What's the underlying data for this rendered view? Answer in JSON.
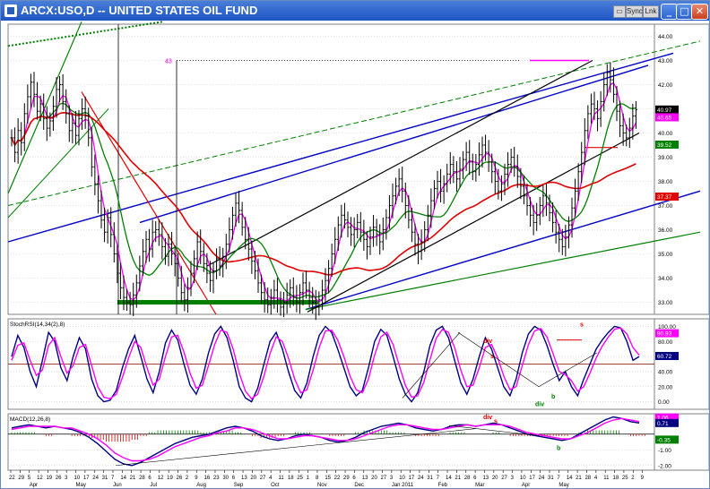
{
  "window": {
    "title": "ARCX:USO,D -- UNITED STATES OIL FUND",
    "toolbar_buttons": [
      "▭",
      "Sync",
      "Lnk"
    ],
    "minimize_icon": "minimize-icon",
    "maximize_icon": "maximize-icon",
    "close_icon": "close-icon"
  },
  "colors": {
    "price_bars": "#000000",
    "magenta": "#ff00ff",
    "green": "#008000",
    "red": "#e00000",
    "blue": "#0000c8",
    "navy": "#000080",
    "grid": "#c8c8c8"
  },
  "chart_data": [
    {
      "type": "bar",
      "title": "ARCX:USO,D -- UNITED STATES OIL FUND",
      "xlabel": "",
      "ylabel": "",
      "ylim": [
        32.5,
        44.5
      ],
      "grid": true,
      "y_ticks": [
        "44.00",
        "43.00",
        "42.00",
        "41.00",
        "40.00",
        "39.00",
        "38.00",
        "37.00",
        "36.00",
        "35.00",
        "34.00",
        "33.00"
      ],
      "price_tags": [
        {
          "label": "40.97",
          "value": 40.97,
          "bg": "#000000",
          "fg": "#ffffff"
        },
        {
          "label": "40.65",
          "value": 40.65,
          "bg": "#ff00ff",
          "fg": "#ffffff"
        },
        {
          "label": "39.52",
          "value": 39.52,
          "bg": "#008000",
          "fg": "#ffffff"
        },
        {
          "label": "37.37",
          "value": 37.37,
          "bg": "#e00000",
          "fg": "#ffffff"
        }
      ],
      "annotations": [
        {
          "text": "43",
          "color": "#ff00ff"
        }
      ],
      "close_series": [
        39.8,
        39.2,
        40.1,
        39.6,
        40.8,
        41.5,
        42.1,
        41.6,
        40.9,
        41.2,
        40.6,
        40.2,
        40.5,
        41.1,
        41.8,
        42.0,
        41.3,
        40.8,
        40.1,
        40.4,
        39.9,
        40.6,
        41.0,
        40.7,
        39.8,
        38.6,
        37.9,
        37.2,
        36.4,
        35.9,
        36.5,
        35.8,
        35.0,
        34.2,
        33.6,
        33.2,
        33.0,
        32.9,
        33.3,
        33.8,
        34.5,
        35.1,
        35.6,
        35.2,
        35.9,
        36.0,
        35.8,
        35.3,
        34.9,
        35.4,
        35.0,
        34.6,
        34.0,
        33.4,
        33.1,
        33.6,
        34.2,
        34.8,
        35.5,
        35.1,
        34.6,
        34.2,
        33.9,
        34.3,
        34.8,
        34.5,
        34.9,
        35.4,
        36.0,
        36.6,
        37.1,
        36.8,
        36.1,
        35.6,
        35.2,
        34.7,
        34.3,
        33.8,
        33.4,
        33.1,
        32.9,
        33.2,
        33.5,
        33.1,
        32.8,
        33.0,
        33.3,
        33.6,
        33.2,
        33.0,
        33.4,
        33.8,
        33.5,
        33.2,
        33.0,
        32.8,
        33.1,
        33.5,
        33.9,
        34.4,
        35.0,
        35.6,
        36.2,
        36.6,
        36.4,
        36.1,
        35.8,
        36.0,
        36.3,
        35.9,
        35.6,
        35.3,
        35.7,
        36.1,
        35.8,
        35.5,
        36.0,
        36.5,
        37.0,
        37.4,
        37.8,
        38.1,
        37.6,
        37.0,
        36.4,
        35.9,
        35.4,
        35.1,
        35.5,
        36.0,
        36.6,
        37.2,
        37.7,
        38.0,
        37.6,
        37.9,
        38.3,
        38.7,
        38.4,
        38.1,
        38.5,
        38.9,
        39.2,
        38.8,
        38.4,
        38.7,
        39.1,
        39.5,
        39.2,
        38.8,
        38.4,
        38.0,
        37.6,
        37.9,
        38.3,
        38.7,
        39.0,
        38.6,
        38.2,
        37.8,
        37.4,
        37.0,
        36.6,
        36.3,
        36.6,
        37.0,
        37.4,
        37.1,
        36.7,
        36.3,
        35.9,
        35.6,
        35.3,
        35.7,
        36.2,
        36.9,
        37.6,
        38.4,
        39.2,
        40.1,
        40.8,
        41.2,
        41.0,
        40.6,
        41.3,
        42.0,
        42.5,
        42.2,
        41.6,
        40.9,
        40.3,
        40.0,
        39.8,
        40.2,
        40.7,
        40.97
      ],
      "moving_averages": [
        {
          "name": "",
          "color": "#ff00ff"
        },
        {
          "name": "",
          "color": "#008000"
        },
        {
          "name": "",
          "color": "#e00000"
        }
      ],
      "date_ticks": [
        "22",
        "29",
        "5",
        "12",
        "19",
        "26",
        "3",
        "10",
        "17",
        "24",
        "31",
        "7",
        "14",
        "21",
        "28",
        "6",
        "12",
        "19",
        "26",
        "2",
        "9",
        "16",
        "23",
        "30",
        "6",
        "13",
        "20",
        "27",
        "4",
        "11",
        "18",
        "25",
        "1",
        "8",
        "15",
        "22",
        "29",
        "6",
        "13",
        "20",
        "27",
        "3",
        "10",
        "17",
        "24",
        "31",
        "7",
        "14",
        "21",
        "28",
        "6",
        "13",
        "20",
        "27",
        "3",
        "10",
        "17",
        "24",
        "31",
        "7",
        "14",
        "21",
        "28",
        "4",
        "11",
        "18",
        "25",
        "2",
        "9"
      ],
      "month_labels": [
        "Apr",
        "May",
        "Jun",
        "Jul",
        "Aug",
        "Sep",
        "Oct",
        "Nov",
        "Dec",
        "Jan 2011",
        "Feb",
        "Mar",
        "Apr",
        "May"
      ]
    },
    {
      "type": "line",
      "title": "StochRSI(14,34(2),8)",
      "xlabel": "",
      "ylabel": "",
      "ylim": [
        -10,
        110
      ],
      "grid": true,
      "y_ticks": [
        "100.00",
        "80.00",
        "60.00",
        "40.00",
        "20.00",
        "0.00"
      ],
      "price_tags": [
        {
          "label": "90.93",
          "value": 90.93,
          "bg": "#ff00ff",
          "fg": "#ffffff"
        },
        {
          "label": "60.72",
          "value": 60.72,
          "bg": "#000080",
          "fg": "#ffffff"
        }
      ],
      "annotations": [
        {
          "text": "div",
          "color": "#e00000"
        },
        {
          "text": "s",
          "color": "#e00000"
        },
        {
          "text": "s",
          "color": "#e00000"
        },
        {
          "text": "div",
          "color": "#008000"
        },
        {
          "text": "b",
          "color": "#008000"
        }
      ],
      "series": [
        {
          "name": "",
          "color": "#000080",
          "values": [
            60,
            88,
            72,
            40,
            20,
            55,
            92,
            80,
            45,
            28,
            60,
            85,
            70,
            30,
            8,
            0,
            2,
            15,
            45,
            70,
            88,
            60,
            30,
            12,
            40,
            78,
            95,
            82,
            50,
            22,
            10,
            30,
            65,
            90,
            100,
            85,
            55,
            20,
            5,
            0,
            18,
            50,
            80,
            92,
            70,
            40,
            15,
            5,
            25,
            60,
            88,
            100,
            92,
            70,
            45,
            20,
            8,
            15,
            45,
            80,
            96,
            88,
            60,
            30,
            10,
            0,
            12,
            40,
            75,
            95,
            100,
            85,
            55,
            25,
            10,
            30,
            60,
            85,
            70,
            45,
            20,
            8,
            30,
            65,
            90,
            100,
            95,
            75,
            50,
            28,
            40,
            20,
            8,
            30,
            50,
            70,
            82,
            92,
            100,
            98,
            80,
            55,
            60
          ]
        },
        {
          "name": "",
          "color": "#ff00ff",
          "values": [
            55,
            75,
            78,
            55,
            35,
            42,
            75,
            85,
            60,
            38,
            48,
            72,
            76,
            48,
            20,
            6,
            4,
            10,
            32,
            58,
            80,
            72,
            45,
            22,
            30,
            60,
            86,
            88,
            66,
            38,
            18,
            22,
            48,
            76,
            95,
            92,
            70,
            38,
            14,
            4,
            10,
            34,
            64,
            86,
            80,
            58,
            30,
            12,
            16,
            42,
            72,
            94,
            95,
            82,
            60,
            34,
            16,
            12,
            30,
            62,
            86,
            92,
            76,
            48,
            22,
            6,
            8,
            26,
            56,
            84,
            96,
            92,
            72,
            42,
            20,
            22,
            45,
            72,
            76,
            58,
            34,
            16,
            20,
            48,
            76,
            94,
            97,
            86,
            64,
            40,
            36,
            28,
            14,
            20,
            38,
            58,
            74,
            86,
            96,
            98,
            90,
            72,
            62
          ]
        }
      ]
    },
    {
      "type": "bar",
      "title": "MACD(12,26,8)",
      "xlabel": "",
      "ylabel": "",
      "ylim": [
        -2.3,
        1.3
      ],
      "grid": true,
      "y_ticks": [
        "1.00",
        "-1.00",
        "-2.00"
      ],
      "price_tags": [
        {
          "label": "1.06",
          "value": 1.06,
          "bg": "#ff00ff",
          "fg": "#ffffff"
        },
        {
          "label": "0.71",
          "value": 0.71,
          "bg": "#000080",
          "fg": "#ffffff"
        },
        {
          "label": "-0.35",
          "value": -0.35,
          "bg": "#008000",
          "fg": "#ffffff"
        }
      ],
      "annotations": [
        {
          "text": "div",
          "color": "#e00000"
        },
        {
          "text": "s",
          "color": "#e00000"
        },
        {
          "text": "b",
          "color": "#008000"
        }
      ],
      "series": [
        {
          "name": "",
          "color": "#000080",
          "values": [
            0.4,
            0.5,
            0.6,
            0.5,
            0.4,
            0.5,
            0.4,
            0.3,
            0.1,
            -0.2,
            -0.6,
            -1.1,
            -1.6,
            -1.9,
            -2.0,
            -1.8,
            -1.5,
            -1.2,
            -0.9,
            -0.6,
            -0.4,
            -0.2,
            -0.1,
            0.0,
            0.2,
            0.4,
            0.5,
            0.4,
            0.2,
            -0.1,
            -0.3,
            -0.4,
            -0.3,
            -0.1,
            0.0,
            -0.1,
            -0.2,
            -0.4,
            -0.5,
            -0.4,
            -0.2,
            0.1,
            0.3,
            0.5,
            0.6,
            0.7,
            0.6,
            0.4,
            0.3,
            0.2,
            0.3,
            0.5,
            0.6,
            0.6,
            0.5,
            0.6,
            0.7,
            0.6,
            0.4,
            0.2,
            0.0,
            -0.1,
            -0.2,
            -0.3,
            -0.4,
            -0.3,
            0.0,
            0.3,
            0.6,
            0.9,
            1.1,
            1.0,
            0.8,
            0.71
          ]
        },
        {
          "name": "",
          "color": "#ff00ff",
          "values": [
            0.3,
            0.4,
            0.5,
            0.5,
            0.5,
            0.5,
            0.4,
            0.4,
            0.2,
            0.0,
            -0.3,
            -0.7,
            -1.2,
            -1.5,
            -1.7,
            -1.7,
            -1.6,
            -1.4,
            -1.1,
            -0.8,
            -0.6,
            -0.4,
            -0.2,
            -0.1,
            0.1,
            0.2,
            0.4,
            0.4,
            0.3,
            0.1,
            -0.1,
            -0.3,
            -0.3,
            -0.2,
            -0.1,
            -0.1,
            -0.2,
            -0.3,
            -0.4,
            -0.4,
            -0.3,
            -0.1,
            0.1,
            0.3,
            0.5,
            0.6,
            0.6,
            0.5,
            0.4,
            0.3,
            0.3,
            0.4,
            0.5,
            0.6,
            0.5,
            0.6,
            0.6,
            0.6,
            0.5,
            0.3,
            0.1,
            0.0,
            -0.1,
            -0.2,
            -0.3,
            -0.3,
            -0.1,
            0.1,
            0.4,
            0.7,
            0.9,
            1.0,
            0.9,
            0.8
          ]
        }
      ]
    }
  ]
}
